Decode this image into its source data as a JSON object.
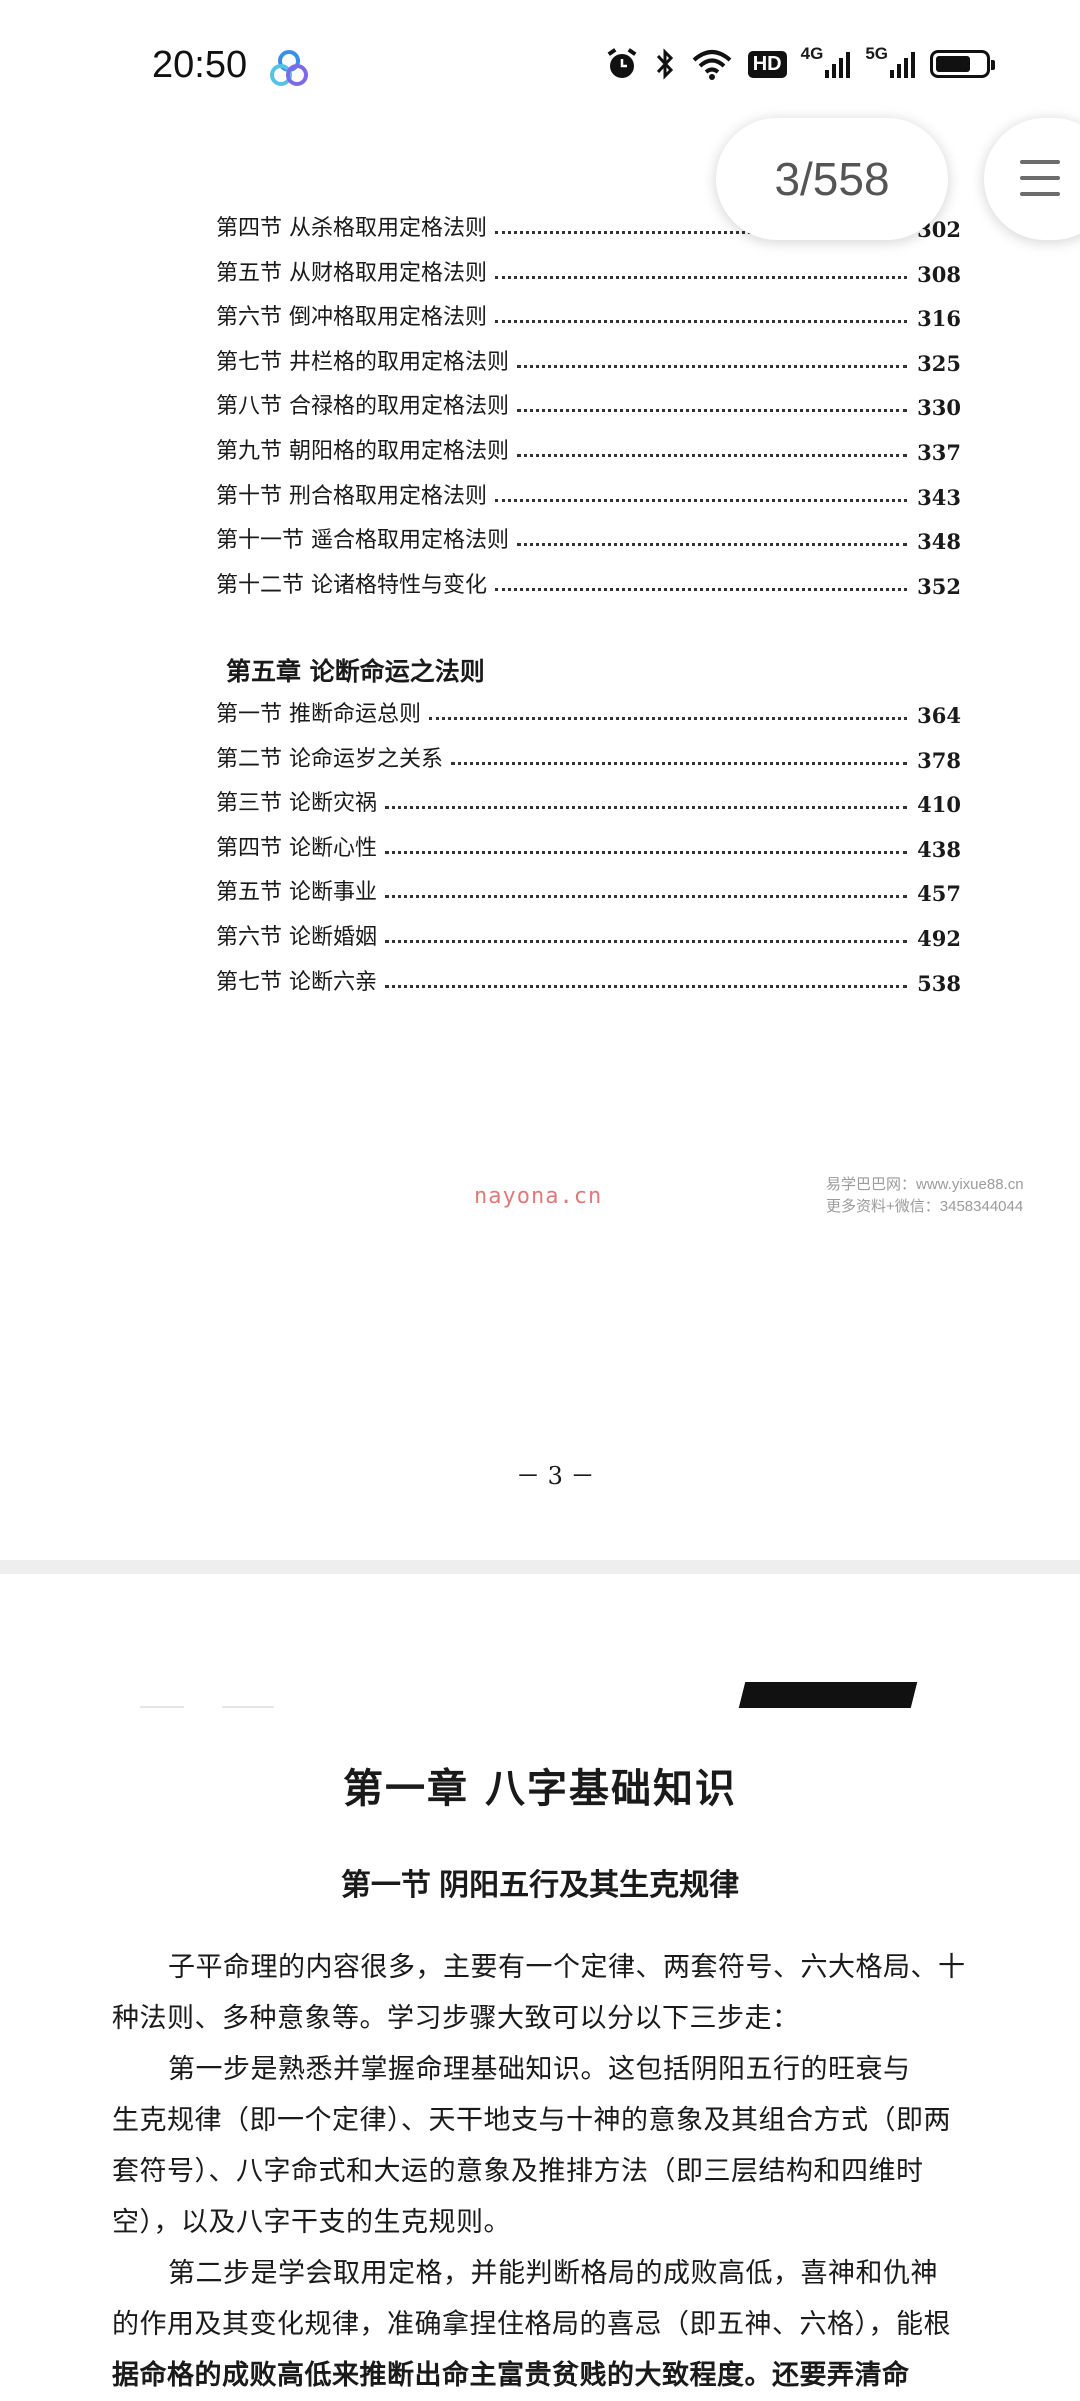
{
  "status_bar": {
    "time": "20:50",
    "network_labels": [
      "HD",
      "4G",
      "5G"
    ],
    "battery_percent": 70
  },
  "reader": {
    "page_indicator": "3/558"
  },
  "toc": {
    "entries_a": [
      {
        "label": "第四节  从杀格取用定格法则",
        "page": "302"
      },
      {
        "label": "第五节  从财格取用定格法则",
        "page": "308"
      },
      {
        "label": "第六节  倒冲格取用定格法则",
        "page": "316"
      },
      {
        "label": "第七节  井栏格的取用定格法则",
        "page": "325"
      },
      {
        "label": "第八节  合禄格的取用定格法则",
        "page": "330"
      },
      {
        "label": "第九节  朝阳格的取用定格法则",
        "page": "337"
      },
      {
        "label": "第十节  刑合格取用定格法则",
        "page": "343"
      },
      {
        "label": "第十一节  遥合格取用定格法则",
        "page": "348"
      },
      {
        "label": "第十二节  论诸格特性与变化",
        "page": "352"
      }
    ],
    "chapter5_title": "第五章  论断命运之法则",
    "entries_b": [
      {
        "label": "第一节  推断命运总则",
        "page": "364"
      },
      {
        "label": "第二节  论命运岁之关系",
        "page": "378"
      },
      {
        "label": "第三节  论断灾祸",
        "page": "410"
      },
      {
        "label": "第四节  论断心性",
        "page": "438"
      },
      {
        "label": "第五节  论断事业",
        "page": "457"
      },
      {
        "label": "第六节  论断婚姻",
        "page": "492"
      },
      {
        "label": "第七节  论断六亲",
        "page": "538"
      }
    ],
    "watermark_left": "nayona.cn",
    "watermark_right_1": "易学巴巴网：www.yixue88.cn",
    "watermark_right_2": "更多资料+微信：3458344044",
    "page_number": "－ 3 －"
  },
  "chapter": {
    "title": "第一章  八字基础知识",
    "section_title": "第一节  阴阳五行及其生克规律",
    "p1": [
      "子平命理的内容很多，主要有一个定律、两套符号、六大格局、十",
      "种法则、多种意象等。学习步骤大致可以分以下三步走："
    ],
    "p2": [
      "第一步是熟悉并掌握命理基础知识。这包括阴阳五行的旺衰与",
      "生克规律（即一个定律）、天干地支与十神的意象及其组合方式（即两",
      "套符号）、八字命式和大运的意象及推排方法（即三层结构和四维时",
      "空），以及八字干支的生克规则。"
    ],
    "p3": [
      "第二步是学会取用定格，并能判断格局的成败高低，喜神和仇神",
      "的作用及其变化规律，准确拿捏住格局的喜忌（即五神、六格），能根",
      "据命格的成败高低来推断出命主富贵贫贱的大致程度。还要弄清命"
    ]
  }
}
